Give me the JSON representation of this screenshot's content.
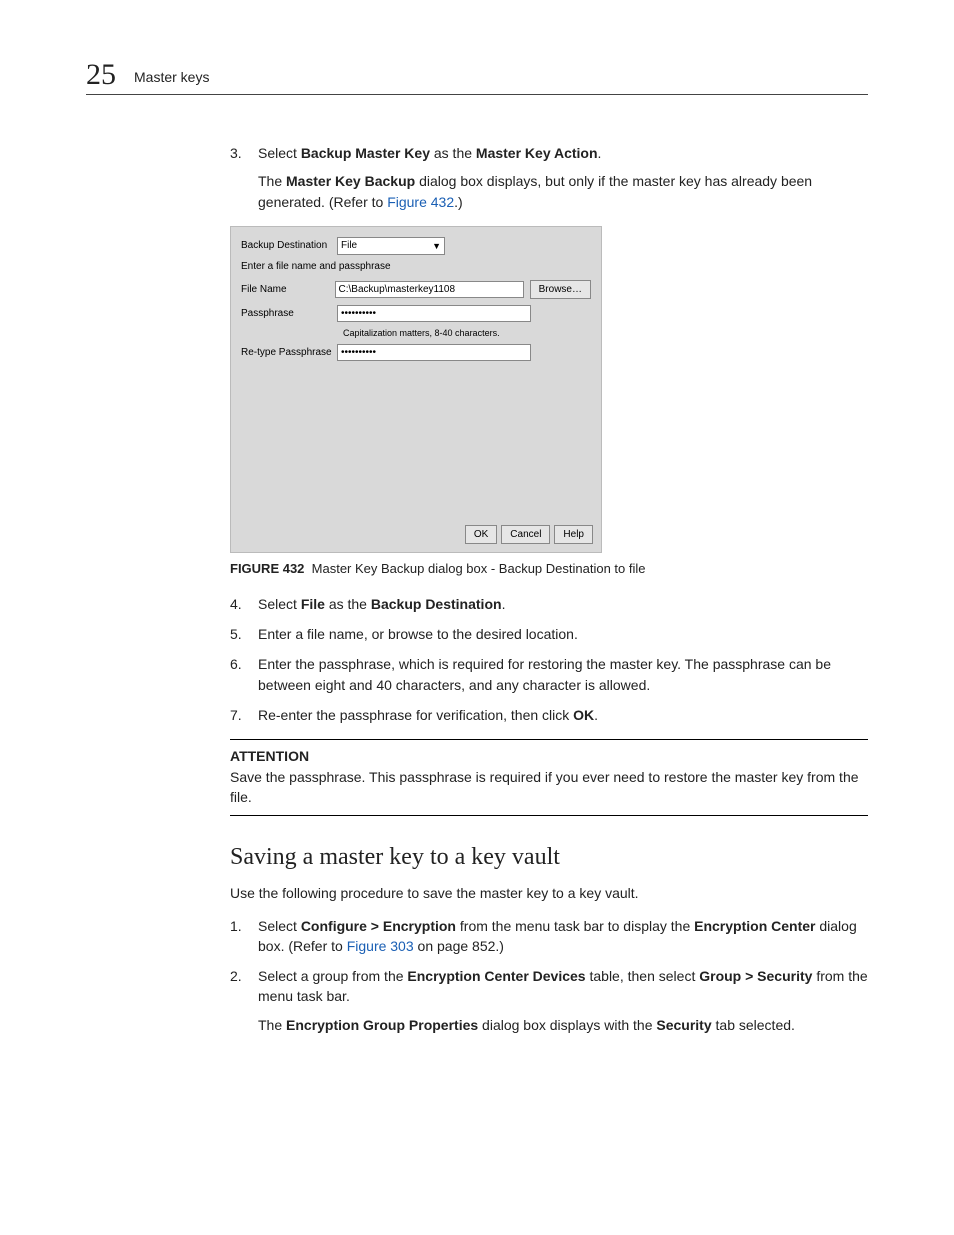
{
  "header": {
    "chapter_number": "25",
    "title": "Master keys"
  },
  "step3": {
    "num": "3.",
    "pre": "Select ",
    "bold1": "Backup Master Key",
    "mid": " as the ",
    "bold2": "Master Key Action",
    "post": ".",
    "follow_pre": "The ",
    "follow_bold": "Master Key Backup",
    "follow_mid": " dialog box displays, but only if the master key has already been generated. (Refer to ",
    "follow_link": "Figure 432",
    "follow_post": ".)"
  },
  "dialog": {
    "dest_label": "Backup Destination",
    "dest_value": "File",
    "subhead": "Enter a file name and passphrase",
    "filename_label": "File Name",
    "filename_value": "C:\\Backup\\masterkey1108",
    "browse": "Browse…",
    "pass_label": "Passphrase",
    "pass_value": "••••••••••",
    "hint": "Capitalization matters, 8-40 characters.",
    "retype_label": "Re-type Passphrase",
    "retype_value": "••••••••••",
    "ok": "OK",
    "cancel": "Cancel",
    "help": "Help"
  },
  "figure": {
    "label": "FIGURE 432",
    "caption": "Master Key Backup dialog box - Backup Destination to file"
  },
  "step4": {
    "num": "4.",
    "pre": "Select ",
    "bold1": "File",
    "mid": " as the ",
    "bold2": "Backup Destination",
    "post": "."
  },
  "step5": {
    "num": "5.",
    "text": "Enter a file name, or browse to the desired location."
  },
  "step6": {
    "num": "6.",
    "text": "Enter the passphrase, which is required for restoring the master key. The passphrase can be between eight and 40 characters, and any character is allowed."
  },
  "step7": {
    "num": "7.",
    "pre": "Re-enter the passphrase for verification, then click ",
    "bold": "OK",
    "post": "."
  },
  "attention": {
    "label": "ATTENTION",
    "text": "Save the passphrase. This passphrase is required if you ever need to restore the master key from the file."
  },
  "section2": {
    "heading": "Saving a master key to a key vault",
    "intro": "Use the following procedure to save the master key to a key vault."
  },
  "s2step1": {
    "num": "1.",
    "pre": "Select ",
    "bold1": "Configure > Encryption",
    "mid": " from the menu task bar to display the ",
    "bold2": "Encryption Center",
    "post1": " dialog box. (Refer to ",
    "link": "Figure 303",
    "post2": " on page 852.)"
  },
  "s2step2": {
    "num": "2.",
    "pre": "Select a group from the ",
    "bold1": "Encryption Center Devices",
    "mid": " table, then select ",
    "bold2": "Group > Security",
    "post": " from the menu task bar.",
    "follow_pre": "The ",
    "follow_bold1": "Encryption Group Properties",
    "follow_mid": " dialog box displays with the ",
    "follow_bold2": "Security",
    "follow_post": " tab selected."
  }
}
